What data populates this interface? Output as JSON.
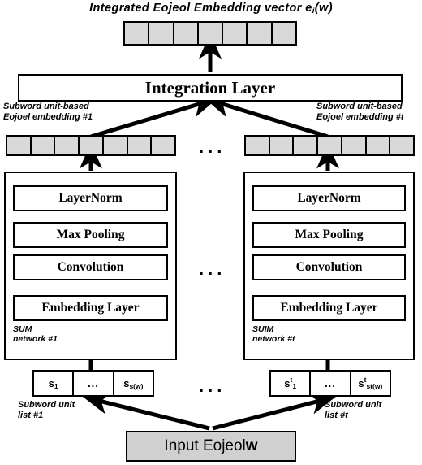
{
  "figure": {
    "title": "Integrated Eojeol Embedding vector e",
    "title_sub": "i",
    "title_tail": "(w)",
    "ellipsis": "...",
    "colors": {
      "vector_cell_fill": "#d9d9d9",
      "input_box_fill": "#d0d0d0",
      "stroke": "#000000",
      "box_fill": "#ffffff"
    }
  },
  "output_vector": {
    "cells": 7
  },
  "integration_layer": {
    "label": "Integration Layer"
  },
  "branches": [
    {
      "id": "left",
      "embedding_caption_line1": "Subword unit-based",
      "embedding_caption_line2": "Eojoel embedding #1",
      "vector_cells": 7,
      "network_caption_line1": "SUM",
      "network_caption_line2": "network #1",
      "layers": [
        "LayerNorm",
        "Max Pooling",
        "Convolution",
        "Embedding Layer"
      ],
      "subword_cells": [
        {
          "base": "s",
          "sup": "",
          "sub": "1"
        },
        {
          "base": "...",
          "sup": "",
          "sub": ""
        },
        {
          "base": "s",
          "sup": "",
          "sub": "s(w)"
        }
      ],
      "list_caption_line1": "Subword unit",
      "list_caption_line2": "list #1"
    },
    {
      "id": "right",
      "embedding_caption_line1": "Subword unit-based",
      "embedding_caption_line2": "Eojoel embedding #t",
      "vector_cells": 7,
      "network_caption_line1": "SUIM",
      "network_caption_line2": "network #t",
      "layers": [
        "LayerNorm",
        "Max Pooling",
        "Convolution",
        "Embedding Layer"
      ],
      "subword_cells": [
        {
          "base": "s",
          "sup": "t",
          "sub": "1"
        },
        {
          "base": "...",
          "sup": "",
          "sub": ""
        },
        {
          "base": "s",
          "sup": "t",
          "sub": "st(w)"
        }
      ],
      "list_caption_line1": "Subword unit",
      "list_caption_line2": "list #t"
    }
  ],
  "input": {
    "label_prefix": "Input Eojeol ",
    "label_var": "w"
  }
}
